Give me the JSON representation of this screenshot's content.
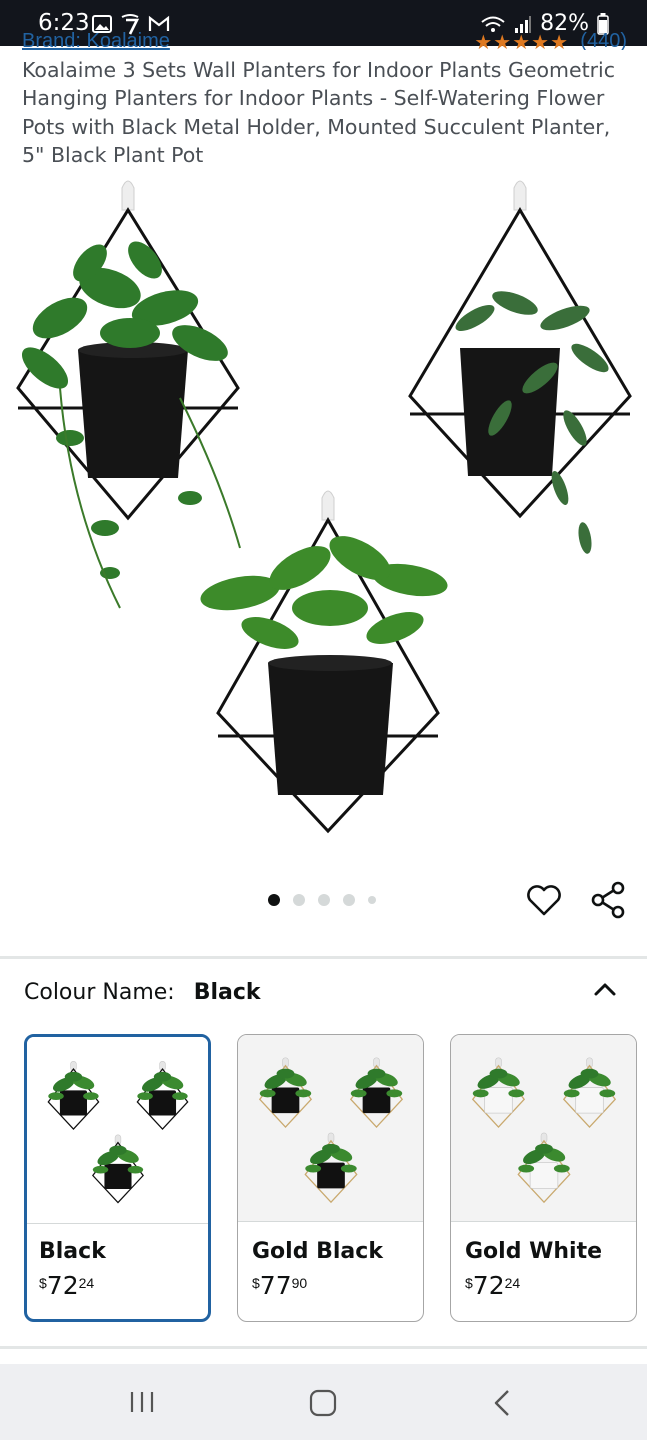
{
  "status_bar": {
    "time": "6:23",
    "battery": "82%",
    "icons": [
      "gallery-icon",
      "notification-7-icon",
      "gmail-icon",
      "wifi-icon",
      "signal-icon",
      "battery-icon"
    ]
  },
  "product": {
    "brand": "Brand: Koalaime",
    "rating_stars": "★★★★★",
    "rating_count": "(440)",
    "title": "Koalaime 3 Sets Wall Planters for Indoor Plants Geometric Hanging Planters for Indoor Plants - Self-Watering Flower Pots with Black Metal Holder, Mounted Succulent Planter, 5\" Black Plant Pot"
  },
  "gallery": {
    "image_count": 5,
    "active_index": 0
  },
  "colour": {
    "label": "Colour Name:",
    "selected": "Black",
    "options": [
      {
        "name": "Black",
        "currency": "$",
        "whole": "72",
        "fraction": "24",
        "frame_color": "#111111",
        "pot_color": "#111111",
        "selected": true
      },
      {
        "name": "Gold Black",
        "currency": "$",
        "whole": "77",
        "fraction": "90",
        "frame_color": "#c9a96e",
        "pot_color": "#111111",
        "selected": false
      },
      {
        "name": "Gold White",
        "currency": "$",
        "whole": "72",
        "fraction": "24",
        "frame_color": "#c9a96e",
        "pot_color": "#f7f7f7",
        "selected": false
      }
    ]
  },
  "colors": {
    "accent_blue": "#2162a1",
    "text": "#0f1111",
    "divider": "#e3e6e6",
    "nav_bg": "#eeeff2"
  }
}
